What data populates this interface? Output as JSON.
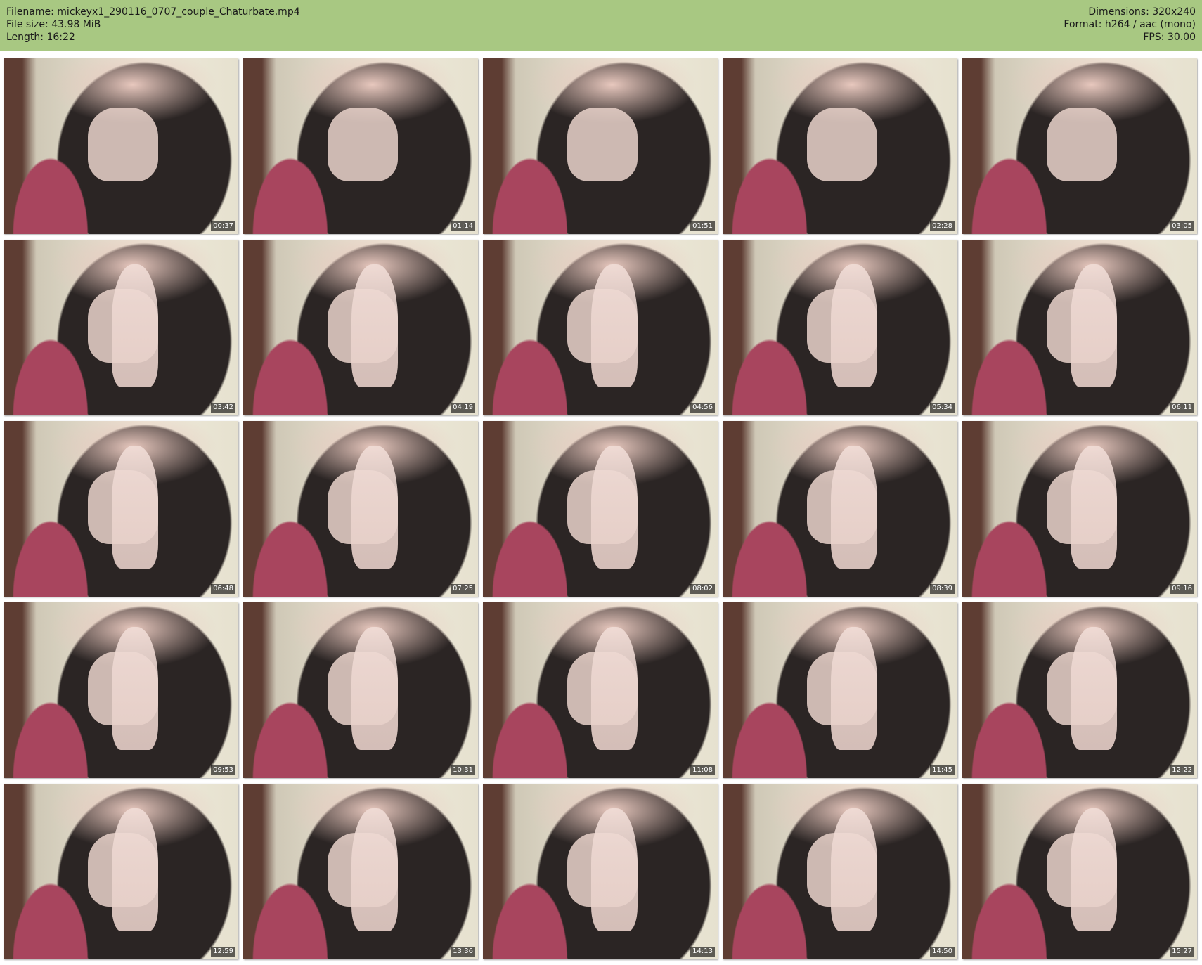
{
  "header": {
    "filename": "Filename: mickeyx1_290116_0707_couple_Chaturbate.mp4",
    "filesize": "File size: 43.98 MiB",
    "length": "Length: 16:22",
    "dimensions": "Dimensions: 320x240",
    "format": "Format: h264 / aac (mono)",
    "fps": "FPS: 30.00"
  },
  "thumbnails": [
    {
      "time": "00:37"
    },
    {
      "time": "01:14"
    },
    {
      "time": "01:51"
    },
    {
      "time": "02:28"
    },
    {
      "time": "03:05"
    },
    {
      "time": "03:42"
    },
    {
      "time": "04:19"
    },
    {
      "time": "04:56"
    },
    {
      "time": "05:34"
    },
    {
      "time": "06:11"
    },
    {
      "time": "06:48"
    },
    {
      "time": "07:25"
    },
    {
      "time": "08:02"
    },
    {
      "time": "08:39"
    },
    {
      "time": "09:16"
    },
    {
      "time": "09:53"
    },
    {
      "time": "10:31"
    },
    {
      "time": "11:08"
    },
    {
      "time": "11:45"
    },
    {
      "time": "12:22"
    },
    {
      "time": "12:59"
    },
    {
      "time": "13:36"
    },
    {
      "time": "14:13"
    },
    {
      "time": "14:50"
    },
    {
      "time": "15:27"
    }
  ],
  "colors": {
    "header_bg": "#a8c882",
    "page_bg": "#ffffff"
  }
}
